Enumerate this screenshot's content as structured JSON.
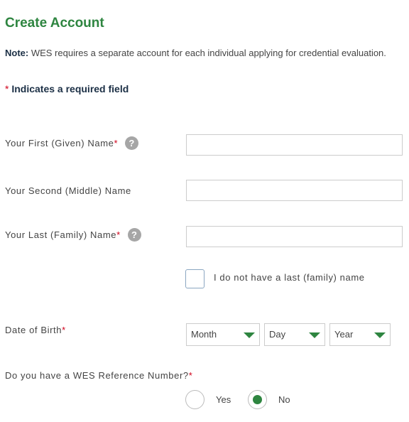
{
  "page": {
    "title": "Create Account"
  },
  "note": {
    "prefix": "Note:",
    "text": " WES requires a separate account for each individual applying for credential evaluation."
  },
  "required_legend": {
    "star": "*",
    "text": " Indicates a required field"
  },
  "fields": {
    "first_name": {
      "label": "Your First (Given) Name",
      "star": "*",
      "help": "?",
      "value": ""
    },
    "middle_name": {
      "label": "Your Second (Middle) Name",
      "value": ""
    },
    "last_name": {
      "label": "Your Last (Family) Name",
      "star": "*",
      "help": "?",
      "value": ""
    },
    "no_last_name": {
      "label": "I do not have a last (family) name",
      "checked": false
    },
    "dob": {
      "label": "Date of Birth",
      "star": "*",
      "month": "Month",
      "day": "Day",
      "year": "Year"
    },
    "wes_ref": {
      "label": "Do you have a WES Reference Number?",
      "star": "*",
      "yes": "Yes",
      "no": "No",
      "selected": "No"
    }
  },
  "colors": {
    "accent": "#2e8540",
    "required": "#d0021b",
    "heading": "#1b2f45"
  }
}
